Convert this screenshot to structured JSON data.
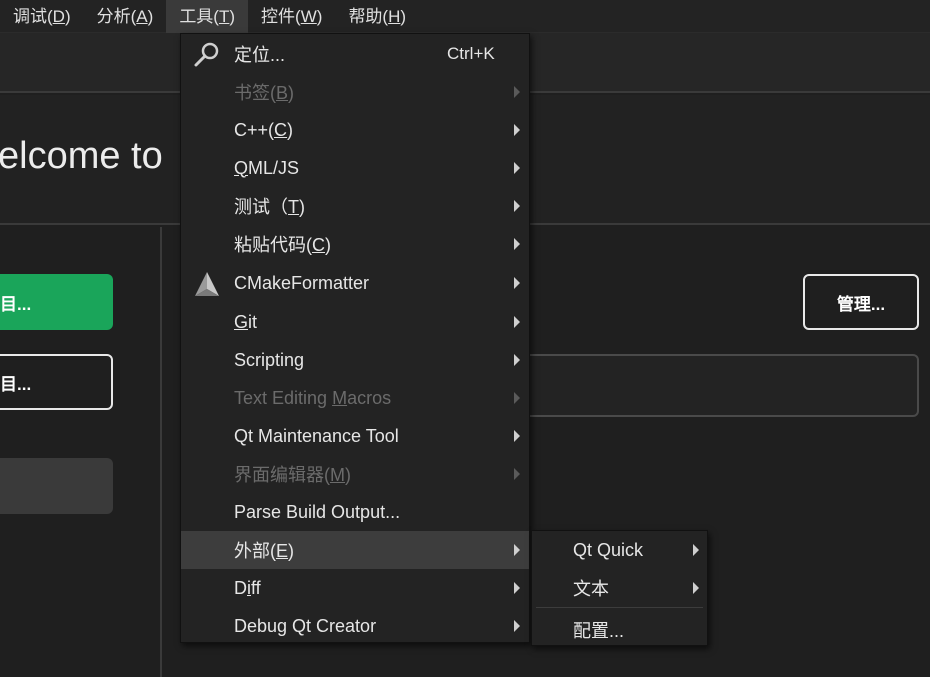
{
  "menubar": {
    "items": [
      {
        "label": "调试(",
        "mnemonic": "D",
        "suffix": ")"
      },
      {
        "label": "分析(",
        "mnemonic": "A",
        "suffix": ")"
      },
      {
        "label": "工具(",
        "mnemonic": "T",
        "suffix": ")"
      },
      {
        "label": "控件(",
        "mnemonic": "W",
        "suffix": ")"
      },
      {
        "label": "帮助(",
        "mnemonic": "H",
        "suffix": ")"
      }
    ]
  },
  "welcome": {
    "title": "elcome to"
  },
  "left_panel": {
    "primary_button": "目...",
    "secondary_button": "目..."
  },
  "content": {
    "manage_button": "管理..."
  },
  "tools_menu": {
    "items": [
      {
        "pre": "定位...",
        "mn": "",
        "post": "",
        "shortcut": "Ctrl+K"
      },
      {
        "pre": "书签(",
        "mn": "B",
        "post": ")"
      },
      {
        "pre": "C++(",
        "mn": "C",
        "post": ")"
      },
      {
        "pre": "",
        "mn": "Q",
        "post": "ML/JS"
      },
      {
        "pre": "测试（",
        "mn": "T",
        "post": ")"
      },
      {
        "pre": "粘贴代码(",
        "mn": "C",
        "post": ")"
      },
      {
        "pre": "CMakeFormatter",
        "mn": "",
        "post": ""
      },
      {
        "pre": "",
        "mn": "G",
        "post": "it"
      },
      {
        "pre": "Scripting",
        "mn": "",
        "post": ""
      },
      {
        "pre": "Text Editing ",
        "mn": "M",
        "post": "acros"
      },
      {
        "pre": "Qt Maintenance Tool",
        "mn": "",
        "post": ""
      },
      {
        "pre": "界面编辑器(",
        "mn": "M",
        "post": ")"
      },
      {
        "pre": "Parse Build Output...",
        "mn": "",
        "post": ""
      },
      {
        "pre": "外部(",
        "mn": "E",
        "post": ")"
      },
      {
        "pre": "D",
        "mn": "i",
        "post": "ff"
      },
      {
        "pre": "Debug Qt Creator",
        "mn": "",
        "post": ""
      }
    ]
  },
  "external_submenu": {
    "items": [
      {
        "label": "Qt Quick"
      },
      {
        "label": "文本"
      },
      {
        "label": "配置..."
      }
    ]
  },
  "icons": {
    "locate": "magnifier-icon",
    "cmake": "cmake-triangle-icon",
    "submenu": "chevron-right-icon"
  }
}
